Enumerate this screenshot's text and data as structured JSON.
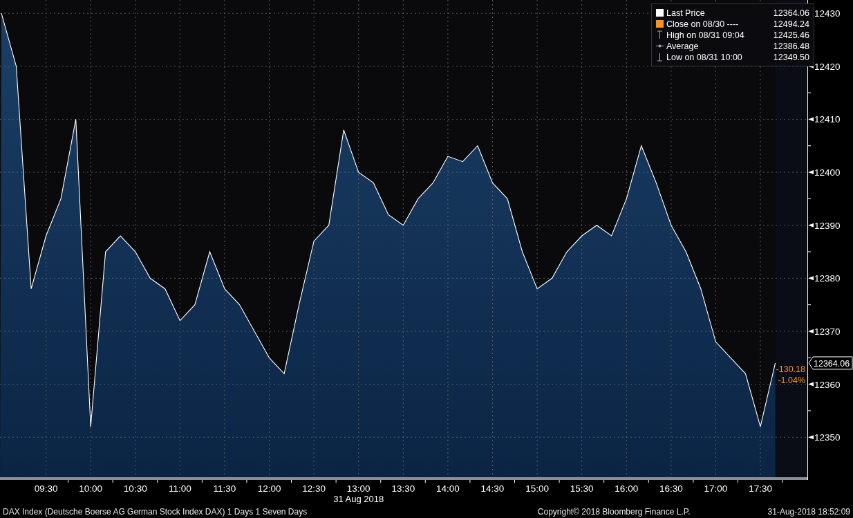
{
  "chart": {
    "chart_data": {
      "type": "area",
      "categories": [
        null,
        null,
        null,
        "09:30",
        null,
        null,
        "10:00",
        null,
        null,
        "10:30",
        null,
        null,
        "11:00",
        null,
        null,
        "11:30",
        null,
        null,
        "12:00",
        null,
        null,
        "12:30",
        null,
        null,
        "13:00",
        null,
        null,
        "13:30",
        null,
        null,
        "14:00",
        null,
        null,
        "14:30",
        null,
        null,
        "15:00",
        null,
        null,
        "15:30",
        null,
        null,
        "16:00",
        null,
        null,
        "16:30",
        null,
        null,
        "17:00",
        null,
        null,
        "17:30",
        null
      ],
      "series": [
        {
          "color": "#ffffff",
          "values": [
            12430,
            12420,
            12378,
            12388,
            12395,
            12410,
            12352,
            12385,
            12388,
            12385,
            12380,
            12378,
            12372,
            12375,
            12385,
            12378,
            12375,
            12370,
            12365,
            12362,
            12375,
            12387,
            12390,
            12408,
            12400,
            12398,
            12392,
            12390,
            12395,
            12398,
            12403,
            12402,
            12405,
            12398,
            12395,
            12385,
            12378,
            12380,
            12385,
            12388,
            12390,
            12388,
            12395,
            12405,
            12398,
            12390,
            12385,
            12378,
            12368,
            12365,
            12362,
            12352,
            12364
          ]
        }
      ],
      "ylim": [
        12342.2,
        12432.5
      ],
      "grid": true,
      "yticks": [
        12350,
        12360,
        12370,
        12380,
        12390,
        12400,
        12410,
        12420,
        12430
      ]
    },
    "date_label": "31 Aug 2018",
    "last_price_tag": "12364.06",
    "change": "-130.18",
    "change_pct": "-1.04%",
    "legend": [
      {
        "kind": "swatch",
        "color": "#ffffff",
        "label": "Last Price",
        "value": "12364.06"
      },
      {
        "kind": "swatch",
        "color": "#f7941d",
        "label": "Close on 08/30 ----",
        "value": "12494.24"
      },
      {
        "kind": "high",
        "label": "High on 08/31 09:04",
        "value": "12425.46"
      },
      {
        "kind": "average",
        "label": "Average",
        "value": "12386.48"
      },
      {
        "kind": "low",
        "label": "Low on 08/31 10:00",
        "value": "12349.50"
      }
    ]
  },
  "footer": {
    "title": "DAX Index (Deutsche Boerse AG German Stock Index DAX) 1 Days 1 Seven Days",
    "copyright": "Copyright© 2018 Bloomberg Finance L.P.",
    "timestamp": "31-Aug-2018 18:52:09"
  }
}
